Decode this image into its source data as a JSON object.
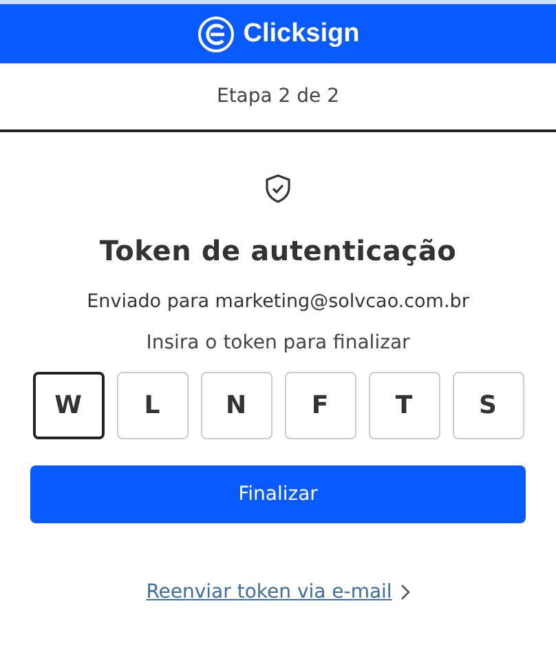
{
  "header": {
    "logo_text": "Clicksign"
  },
  "step": "Etapa 2 de 2",
  "title": "Token de autenticação",
  "sent_to": "Enviado para marketing@solvcao.com.br",
  "instruction": "Insira o token para finalizar",
  "token": [
    {
      "value": "W",
      "focused": true
    },
    {
      "value": "L",
      "focused": false
    },
    {
      "value": "N",
      "focused": false
    },
    {
      "value": "F",
      "focused": false
    },
    {
      "value": "T",
      "focused": false
    },
    {
      "value": "S",
      "focused": false
    }
  ],
  "submit_button": "Finalizar",
  "resend_link": "Reenviar token via e-mail"
}
